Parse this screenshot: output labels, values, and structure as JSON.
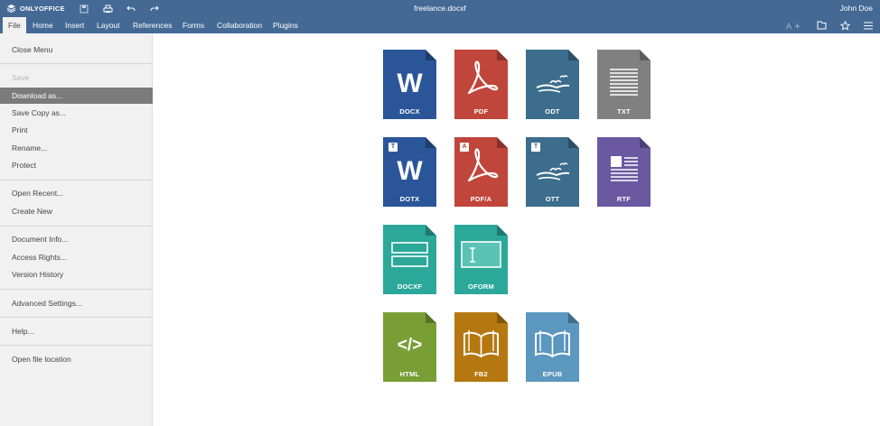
{
  "titlebar": {
    "logo_text": "ONLYOFFICE",
    "document_title": "freelance.docxf",
    "user_name": "John Doe",
    "bg_color": "#446995"
  },
  "menubar": {
    "tabs": [
      {
        "label": "File",
        "active": true
      },
      {
        "label": "Home",
        "active": false
      },
      {
        "label": "Insert",
        "active": false
      },
      {
        "label": "Layout",
        "active": false
      },
      {
        "label": "References",
        "active": false
      },
      {
        "label": "Forms",
        "active": false
      },
      {
        "label": "Collaboration",
        "active": false
      },
      {
        "label": "Plugins",
        "active": false
      }
    ]
  },
  "file_menu": {
    "items": [
      {
        "label": "Close Menu",
        "state": "normal"
      },
      {
        "label": "Save",
        "state": "disabled"
      },
      {
        "label": "Download as...",
        "state": "selected"
      },
      {
        "label": "Save Copy as...",
        "state": "normal"
      },
      {
        "label": "Print",
        "state": "normal"
      },
      {
        "label": "Rename...",
        "state": "normal"
      },
      {
        "label": "Protect",
        "state": "normal"
      },
      {
        "label": "Open Recent...",
        "state": "normal"
      },
      {
        "label": "Create New",
        "state": "normal"
      },
      {
        "label": "Document Info...",
        "state": "normal"
      },
      {
        "label": "Access Rights...",
        "state": "normal"
      },
      {
        "label": "Version History",
        "state": "normal"
      },
      {
        "label": "Advanced Settings...",
        "state": "normal"
      },
      {
        "label": "Help...",
        "state": "normal"
      },
      {
        "label": "Open file location",
        "state": "normal"
      }
    ]
  },
  "formats": [
    {
      "label": "DOCX",
      "color": "#2a5699",
      "glyph": "word",
      "badge": ""
    },
    {
      "label": "PDF",
      "color": "#c0453a",
      "glyph": "pdf",
      "badge": ""
    },
    {
      "label": "ODT",
      "color": "#3c6d8c",
      "glyph": "odt",
      "badge": ""
    },
    {
      "label": "TXT",
      "color": "#808080",
      "glyph": "txt",
      "badge": ""
    },
    {
      "label": "DOTX",
      "color": "#2a5699",
      "glyph": "word",
      "badge": "T"
    },
    {
      "label": "PDF/A",
      "color": "#c0453a",
      "glyph": "pdf",
      "badge": "A"
    },
    {
      "label": "OTT",
      "color": "#3c6d8c",
      "glyph": "odt",
      "badge": "T"
    },
    {
      "label": "RTF",
      "color": "#6a58a1",
      "glyph": "rtf",
      "badge": ""
    },
    {
      "label": "DOCXF",
      "color": "#2ba89a",
      "glyph": "docxf",
      "badge": ""
    },
    {
      "label": "OFORM",
      "color": "#2ba89a",
      "glyph": "oform",
      "badge": ""
    },
    {
      "label": "HTML",
      "color": "#7a9e36",
      "glyph": "html",
      "badge": ""
    },
    {
      "label": "FB2",
      "color": "#b5770f",
      "glyph": "book",
      "badge": ""
    },
    {
      "label": "EPUB",
      "color": "#5b97be",
      "glyph": "book",
      "badge": ""
    }
  ]
}
